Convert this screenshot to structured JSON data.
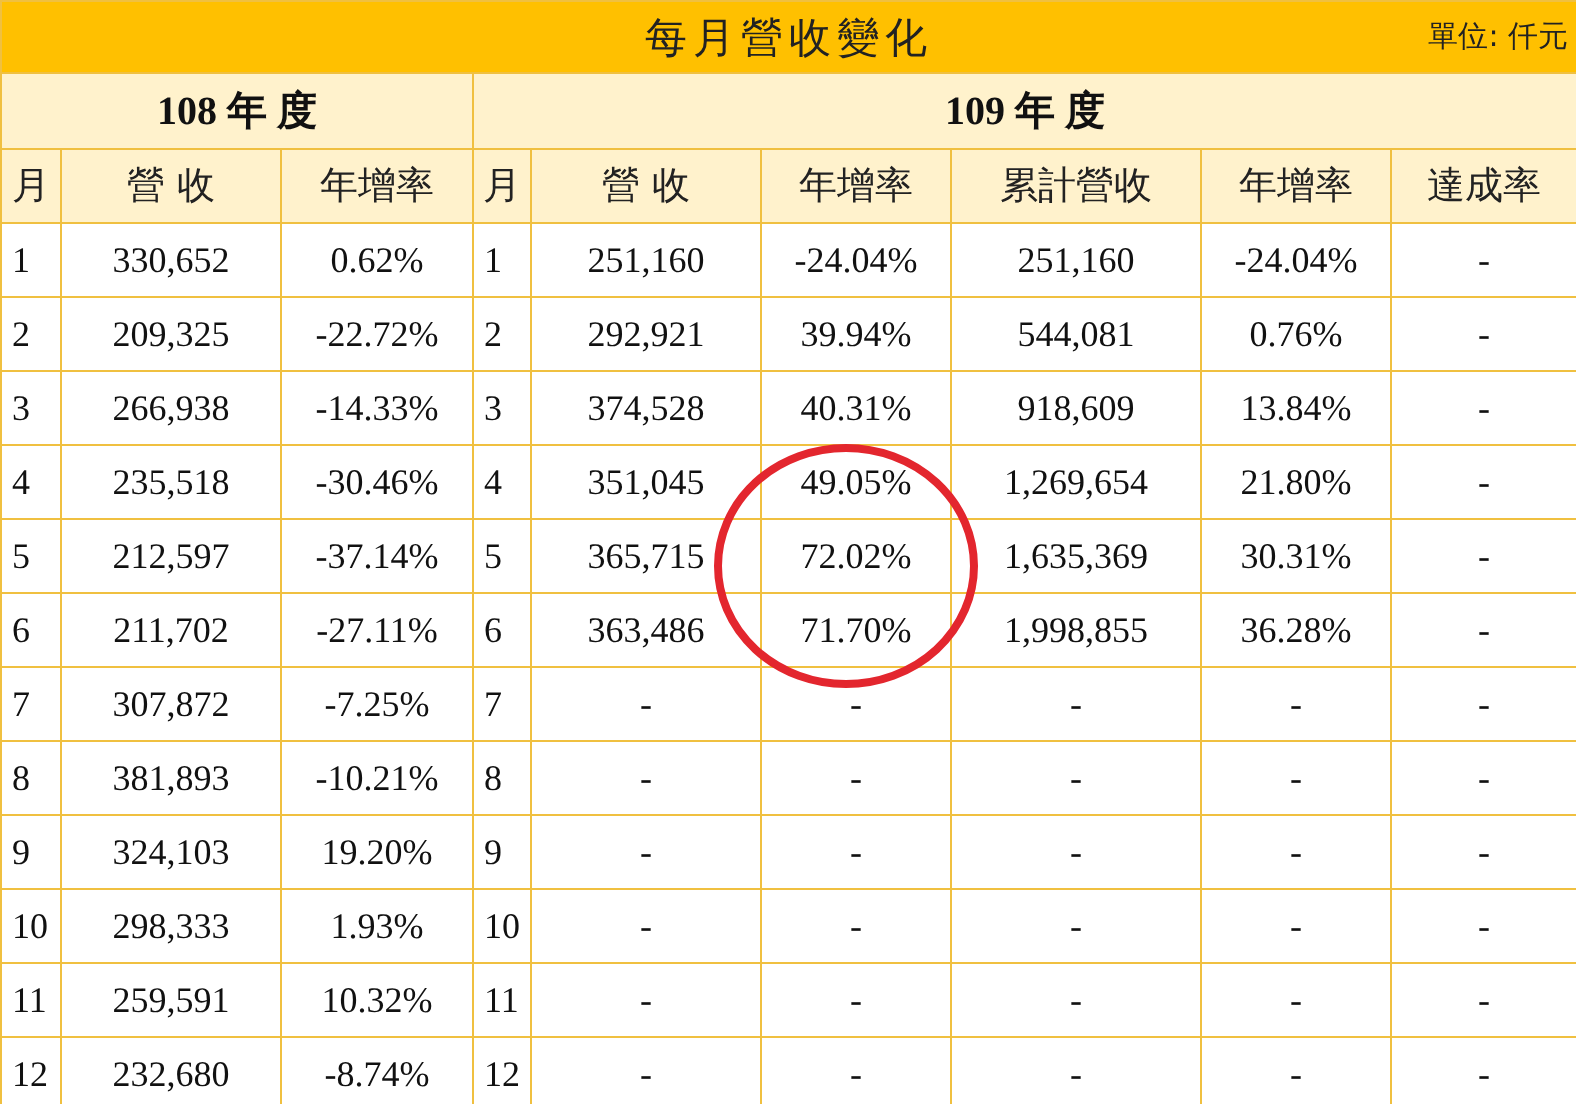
{
  "title": "每月營收變化",
  "unit": "單位: 仟元",
  "year_groups": [
    {
      "label": "108 年 度"
    },
    {
      "label": "109 年 度"
    }
  ],
  "columns": [
    "月",
    "營 收",
    "年增率",
    "月",
    "營 收",
    "年增率",
    "累計營收",
    "年增率",
    "達成率"
  ],
  "rows": [
    [
      "1",
      "330,652",
      "0.62%",
      "1",
      "251,160",
      "-24.04%",
      "251,160",
      "-24.04%",
      "-"
    ],
    [
      "2",
      "209,325",
      "-22.72%",
      "2",
      "292,921",
      "39.94%",
      "544,081",
      "0.76%",
      "-"
    ],
    [
      "3",
      "266,938",
      "-14.33%",
      "3",
      "374,528",
      "40.31%",
      "918,609",
      "13.84%",
      "-"
    ],
    [
      "4",
      "235,518",
      "-30.46%",
      "4",
      "351,045",
      "49.05%",
      "1,269,654",
      "21.80%",
      "-"
    ],
    [
      "5",
      "212,597",
      "-37.14%",
      "5",
      "365,715",
      "72.02%",
      "1,635,369",
      "30.31%",
      "-"
    ],
    [
      "6",
      "211,702",
      "-27.11%",
      "6",
      "363,486",
      "71.70%",
      "1,998,855",
      "36.28%",
      "-"
    ],
    [
      "7",
      "307,872",
      "-7.25%",
      "7",
      "-",
      "-",
      "-",
      "-",
      "-"
    ],
    [
      "8",
      "381,893",
      "-10.21%",
      "8",
      "-",
      "-",
      "-",
      "-",
      "-"
    ],
    [
      "9",
      "324,103",
      "19.20%",
      "9",
      "-",
      "-",
      "-",
      "-",
      "-"
    ],
    [
      "10",
      "298,333",
      "1.93%",
      "10",
      "-",
      "-",
      "-",
      "-",
      "-"
    ],
    [
      "11",
      "259,591",
      "10.32%",
      "11",
      "-",
      "-",
      "-",
      "-",
      "-"
    ],
    [
      "12",
      "232,680",
      "-8.74%",
      "12",
      "-",
      "-",
      "-",
      "-",
      "-"
    ]
  ]
}
